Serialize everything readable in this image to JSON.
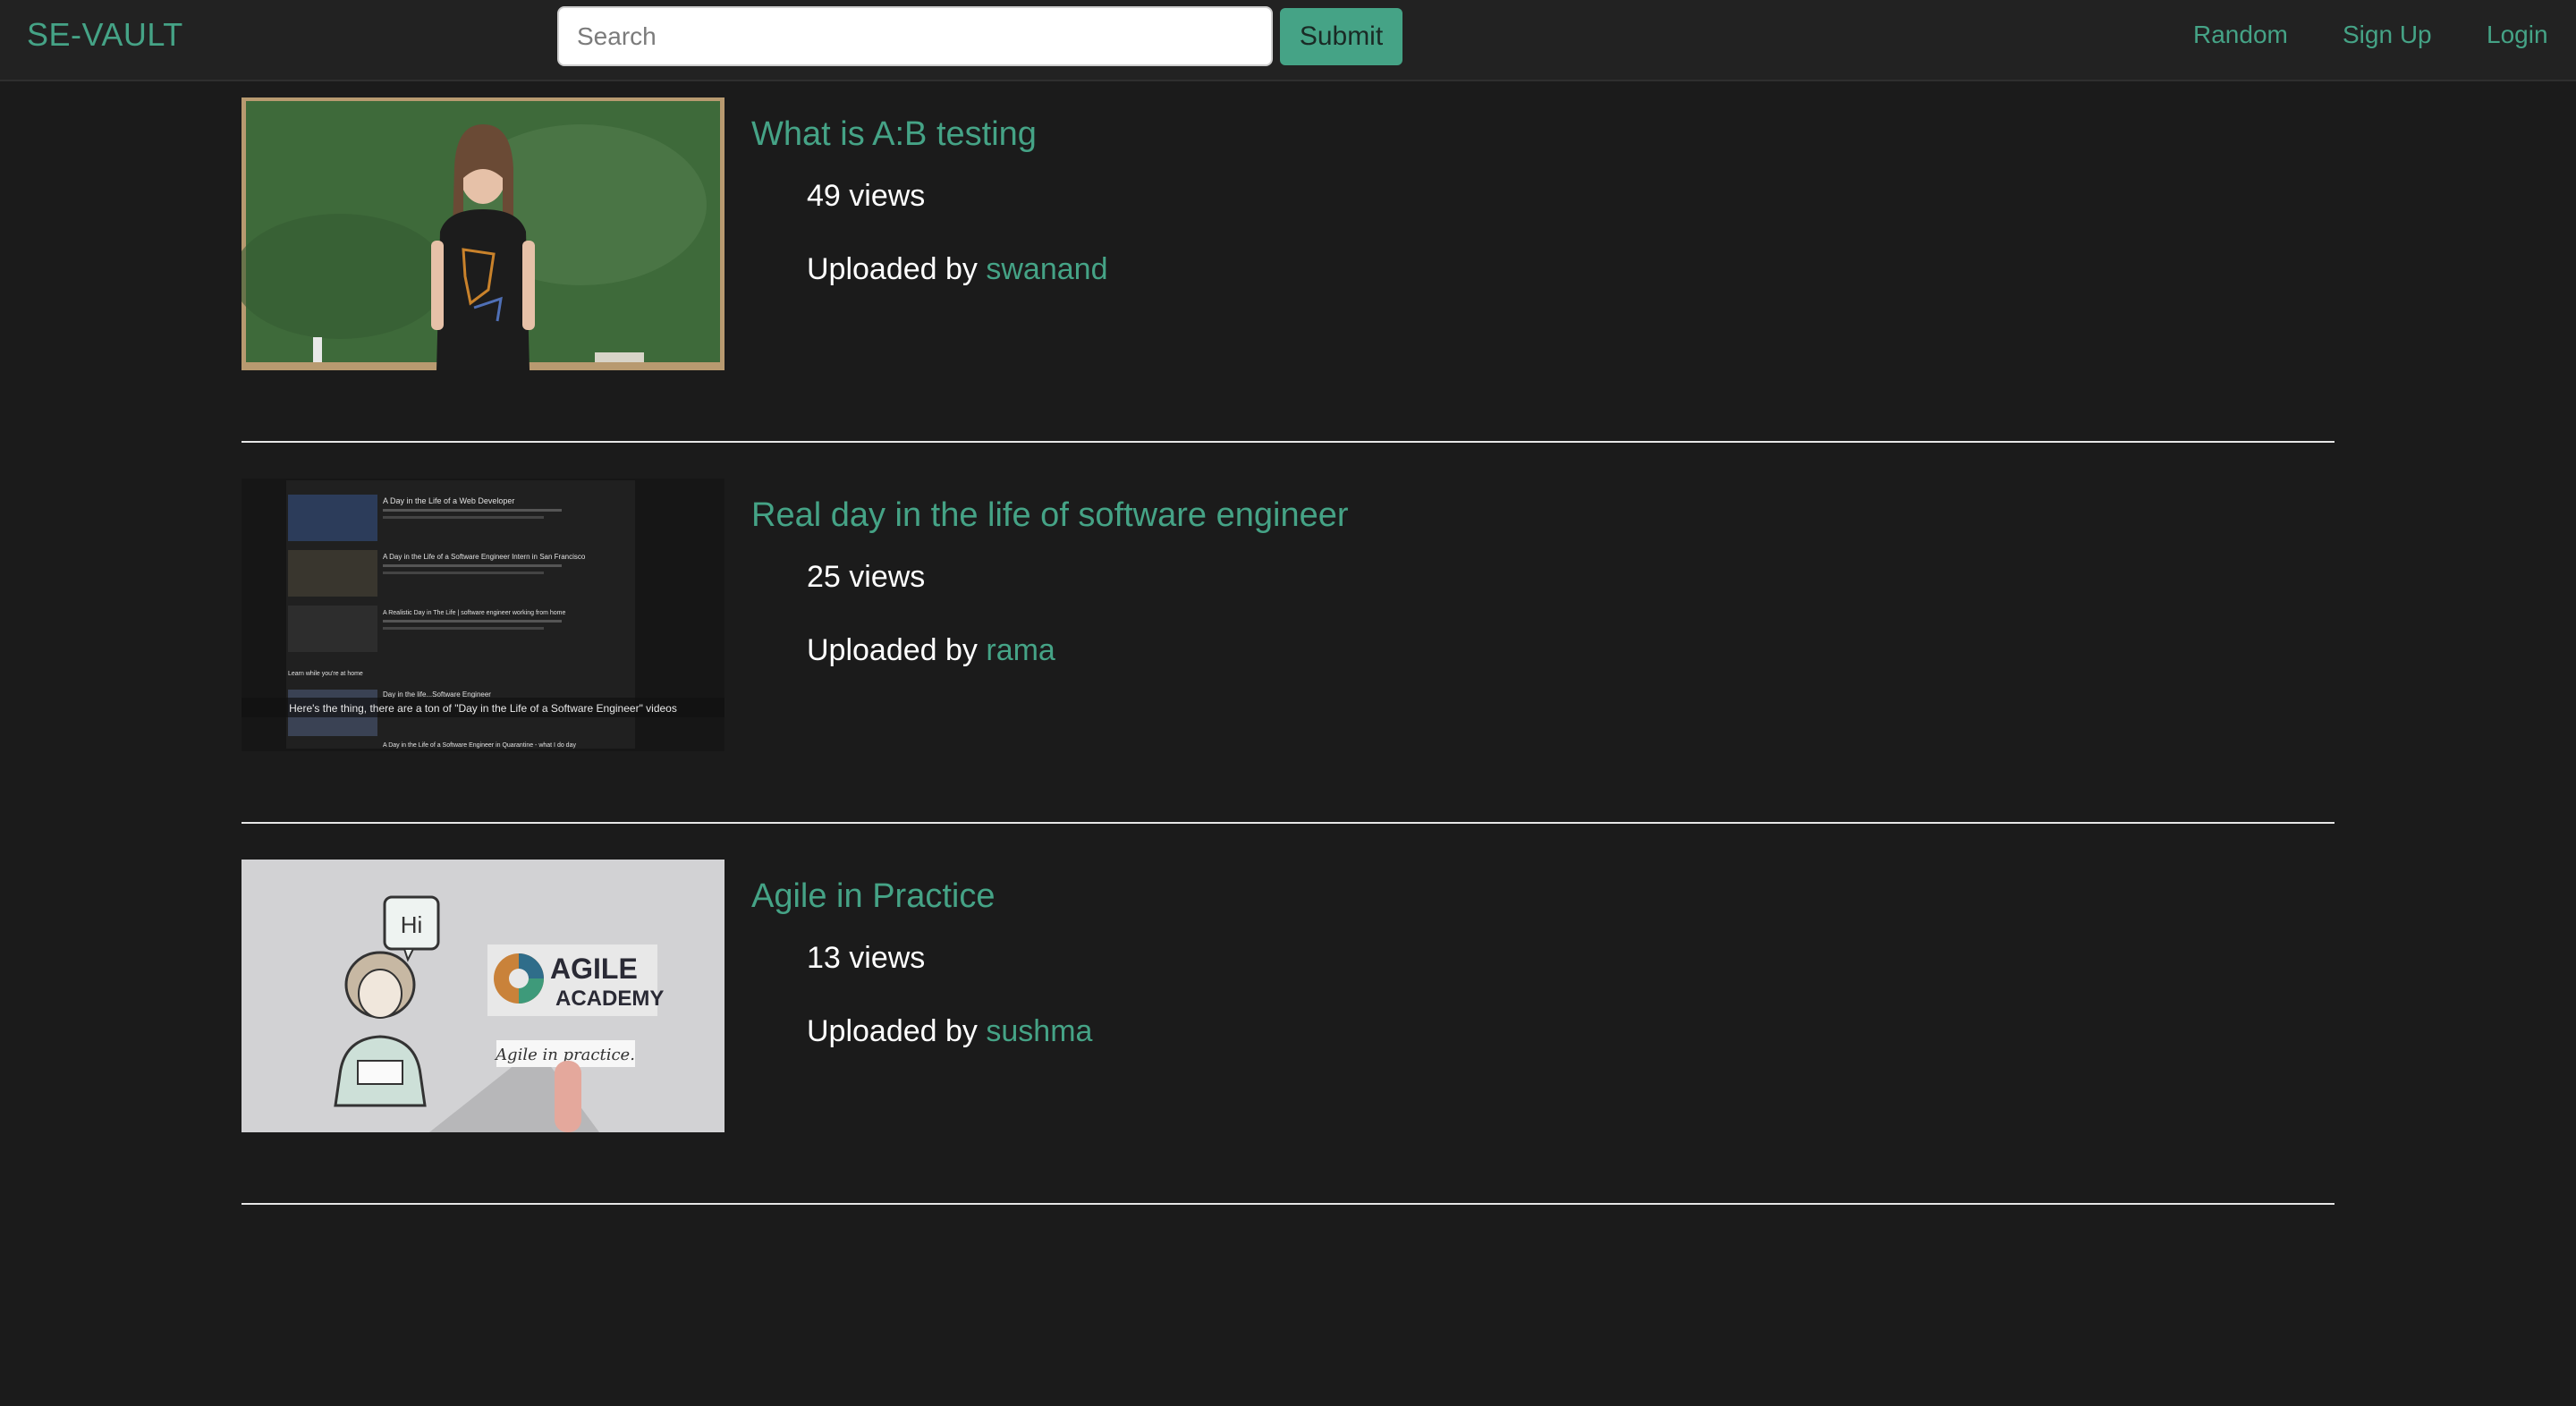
{
  "app": {
    "brand": "SE-VAULT"
  },
  "search": {
    "placeholder": "Search",
    "value": "",
    "submit_label": "Submit"
  },
  "nav": {
    "random": "Random",
    "signup": "Sign Up",
    "login": "Login"
  },
  "videos": [
    {
      "title": "What is A:B testing",
      "views": "49 views",
      "uploaded_prefix": "Uploaded by",
      "uploader": "swanand",
      "thumbnail": "chalkboard-presenter-thumbnail"
    },
    {
      "title": "Real day in the life of software engineer",
      "views": "25 views",
      "uploaded_prefix": "Uploaded by",
      "uploader": "rama",
      "thumbnail": "video-list-screenshot-thumbnail",
      "thumbnail_caption": "Here's the thing, there are a ton of \"Day in the Life of a Software Engineer\" videos",
      "thumbnail_list": [
        "A Day in the Life of a Web Developer",
        "A Day in the Life of a Software Engineer Intern in San Francisco",
        "A Realistic Day in The Life | software engineer working from home",
        "Learn while you're at home",
        "Day in the life...Software Engineer",
        "A Day in the Life of a Software Engineer in Quarantine - what I do day"
      ]
    },
    {
      "title": "Agile in Practice",
      "views": "13 views",
      "uploaded_prefix": "Uploaded by",
      "uploader": "sushma",
      "thumbnail": "agile-academy-thumbnail",
      "thumbnail_text": {
        "bubble": "Hi",
        "logo_line1": "AGILE",
        "logo_line2": "ACADEMY",
        "card": "Agile in practice."
      }
    }
  ],
  "colors": {
    "accent": "#45a386",
    "background": "#1b1b1b",
    "navbar": "#222222"
  }
}
